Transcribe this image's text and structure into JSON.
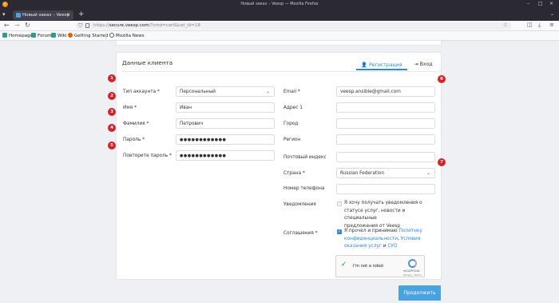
{
  "window": {
    "title": "Новый заказ – Veesp — Mozilla Firefox"
  },
  "tab": {
    "title": "Новый заказ – Veesp",
    "close": "×",
    "new": "+"
  },
  "nav": {
    "back": "←",
    "forward": "→",
    "reload": "↻",
    "url_gray": "https://",
    "url_host": "secure.veesp.com",
    "url_path": "/?cmd=cart&cat_id=18"
  },
  "bookmarks": [
    {
      "label": "Homepage",
      "color": "#2a9d8f"
    },
    {
      "label": "Forum",
      "color": "#2a9d8f"
    },
    {
      "label": "Wiki",
      "color": "#2a9d8f"
    },
    {
      "label": "Getting Started",
      "color": "#e66000"
    },
    {
      "label": "Mozilla News",
      "color": "#555555"
    }
  ],
  "client": {
    "title": "Данные клиента",
    "tab_register": "Регистрация",
    "tab_login": "Вход"
  },
  "form_left": {
    "account_type_label": "Тип аккаунта *",
    "account_type_value": "Персональный",
    "first_name_label": "Имя *",
    "first_name_value": "Иван",
    "last_name_label": "Фамилия *",
    "last_name_value": "Петрович",
    "password_label": "Пароль *",
    "password_value": "●●●●●●●●●●●●",
    "password2_label": "Повторите пароль *",
    "password2_value": "●●●●●●●●●●●●"
  },
  "form_right": {
    "email_label": "Email *",
    "email_value": "veesp.ansible@gmail.com",
    "address_label": "Адрес 1",
    "city_label": "Город",
    "region_label": "Регион",
    "zip_label": "Почтовый индекс",
    "country_label": "Страна *",
    "country_value": "Russian Federation",
    "phone_label": "Номер телефона",
    "notify_label": "Уведомления",
    "notify_text_1": "Я хочу получать уведомления о",
    "notify_text_2": "статусе услуг, новости и специальные",
    "notify_text_3": "предложения от Veesp",
    "agree_label": "Соглашения *",
    "agree_text_1": "Я прочел и принимаю ",
    "agree_link_1": "Политику",
    "agree_link_2": "конфиденциальности",
    "agree_sep": ", ",
    "agree_link_3": "Условия",
    "agree_link_4": "оказания услуг",
    "agree_and": " и ",
    "agree_link_5": "СУО"
  },
  "captcha": {
    "label": "I'm not a robot",
    "brand": "reCAPTCHA",
    "terms": "Privacy - Terms"
  },
  "markers": [
    "1",
    "2",
    "3",
    "4",
    "5",
    "6",
    "7"
  ],
  "continue_button": "Продолжить",
  "colors": {
    "accent": "#2a8bd6",
    "marker": "#d92026",
    "button": "#4aa3df"
  }
}
